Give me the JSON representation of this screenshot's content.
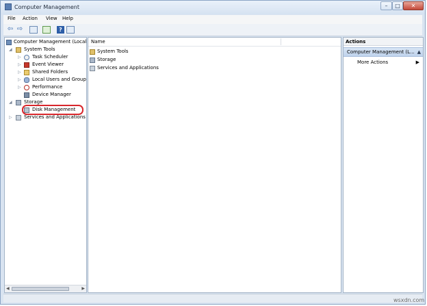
{
  "window": {
    "title": "Computer Management",
    "controls": {
      "minimize": "–",
      "maximize": "□",
      "close": "✕"
    }
  },
  "menu": [
    "File",
    "Action",
    "View",
    "Help"
  ],
  "toolbar": {
    "back": "⇦",
    "forward": "⇨",
    "icons": [
      "back-icon",
      "forward-icon",
      "show-hide-tree-icon",
      "export-list-icon",
      "help-icon",
      "show-hide-action-pane-icon"
    ],
    "help_glyph": "?"
  },
  "tree": {
    "root": "Computer Management (Local",
    "system_tools": "System Tools",
    "children": [
      {
        "label": "Task Scheduler",
        "icon": "clock-icon"
      },
      {
        "label": "Event Viewer",
        "icon": "event-viewer-icon"
      },
      {
        "label": "Shared Folders",
        "icon": "folder-icon"
      },
      {
        "label": "Local Users and Groups",
        "icon": "users-icon"
      },
      {
        "label": "Performance",
        "icon": "performance-icon"
      },
      {
        "label": "Device Manager",
        "icon": "device-icon"
      }
    ],
    "storage": "Storage",
    "disk_management": "Disk Management",
    "services": "Services and Applications",
    "expand_glyph": "▷",
    "collapse_glyph": "◢"
  },
  "list": {
    "column": "Name",
    "rows": [
      "System Tools",
      "Storage",
      "Services and Applications"
    ]
  },
  "actions": {
    "header": "Actions",
    "section": "Computer Management (L...",
    "more": "More Actions",
    "collapse_glyph": "▲",
    "more_glyph": "▶"
  },
  "highlight_color": "#d8262b",
  "watermark": "wsxdn.com"
}
